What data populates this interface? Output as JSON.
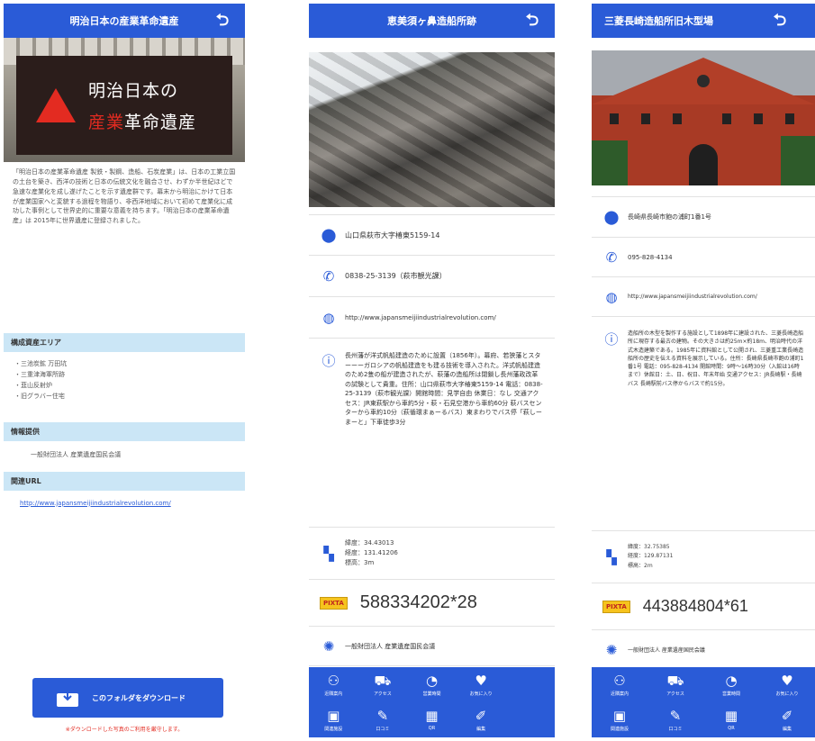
{
  "screen1": {
    "title": "明治日本の産業革命遺産",
    "hero_line1": "明治日本の",
    "hero_line2_red": "産業",
    "hero_line2_rest": "革命遺産",
    "intro": "「明治日本の産業革命遺産 製鉄・製鋼、造船、石炭産業」は、日本の工業立国の土台を築き、西洋の技術と日本の伝統文化を融合させ、わずか半世紀ほどで急速な産業化を成し遂げたことを示す遺産群です。幕末から明治にかけて日本が産業国家へと変貌する過程を物語り、非西洋地域において初めて産業化に成功した事例として世界史的に重要な意義を持ちます。「明治日本の産業革命遺産」は 2015年に世界遺産に登録されました。",
    "sec1_header": "構成資産エリア",
    "sec1_items": [
      "・三池炭鉱 万田坑",
      "・三重津海軍所跡",
      "・韮山反射炉",
      "・旧グラバー住宅"
    ],
    "sec2_header": "情報提供",
    "sec2_text": "一般財団法人 産業遺産国民会議",
    "sec3_header": "関連URL",
    "sec3_link": "http://www.japansmeijiindustrialrevolution.com/",
    "download_label": "このフォルダをダウンロード",
    "download_note": "※ダウンロードした写真のご利用を厳守します。"
  },
  "screen2": {
    "title": "恵美須ヶ鼻造船所跡",
    "address": "山口県萩市大字椿東5159-14",
    "phone": "0838-25-3139（萩市観光課）",
    "url": "http://www.japansmeijiindustrialrevolution.com/",
    "info": "長州藩が洋式帆船建造のために設置（1856年）。幕府、若狭藩とスターーーガロシアの帆船建造をも建る技術を導入された。洋式帆船建造のため2隻の船が建造されたが、萩藩の造船所は閉鎖し長州藩政改革の試験として貴重。住所：山口県萩市大字椿東5159-14 電話：0838-25-3139（萩市観光課）開館時間：見学自由 休業日：なし 交通アクセス：JR東萩駅から車約5分・萩・石見空港から車約60分 萩バスセンターから車約10分（萩循環まぁーるバス）東まわりでバス停「萩しーまーと」下車徒歩3分",
    "lat": "緯度：34.43013",
    "lng": "経度：131.41206",
    "alt": "標高：3m",
    "code_badge": "PIXTA",
    "code": "588334202*28",
    "org": "一般財団法人 産業遺産国民会議"
  },
  "screen3": {
    "title": "三菱長崎造船所旧木型場",
    "address": "長崎県長崎市飽の浦町1番1号",
    "phone": "095-828-4134",
    "url": "http://www.japansmeijiindustrialrevolution.com/",
    "info": "造船所の木型を製作する施設として1898年に建設された、三菱長崎造船所に現存する最古の建物。その大きさは約25m×約18m、明治時代の洋式木造建築である。1985年に資料館として公開され、三菱重工業長崎造船所の歴史を伝える資料を展示している。住所：長崎県長崎市飽の浦町1番1号 電話：095-828-4134 開館時間：9時〜16時30分（入館は16時まで）休館日：土、日、祝日、年末年始 交通アクセス：JR長崎駅・長崎バス 長崎駅前バス停からバスで約15分。",
    "lat": "緯度：32.75385",
    "lng": "経度：129.87131",
    "alt": "標高：2m",
    "code_badge": "PIXTA",
    "code": "443884804*61",
    "org": "一般財団法人 産業遺産国民会議"
  },
  "nav": [
    {
      "icon": "people-icon",
      "glyph": "⚇",
      "label": "近隣案内"
    },
    {
      "icon": "car-icon",
      "glyph": "⛟",
      "label": "アクセス"
    },
    {
      "icon": "clock-icon",
      "glyph": "◔",
      "label": "営業時間"
    },
    {
      "icon": "heart-icon",
      "glyph": "♥",
      "label": "お気に入り"
    },
    {
      "icon": "person-card-icon",
      "glyph": "▣",
      "label": "関連施設"
    },
    {
      "icon": "chat-icon",
      "glyph": "✎",
      "label": "口コミ"
    },
    {
      "icon": "qr-icon",
      "glyph": "▦",
      "label": "QR"
    },
    {
      "icon": "edit-icon",
      "glyph": "✐",
      "label": "編集"
    }
  ],
  "colors": {
    "header": "#2a5bd7",
    "section": "#cbe6f6",
    "accent_red": "#e32b21"
  }
}
